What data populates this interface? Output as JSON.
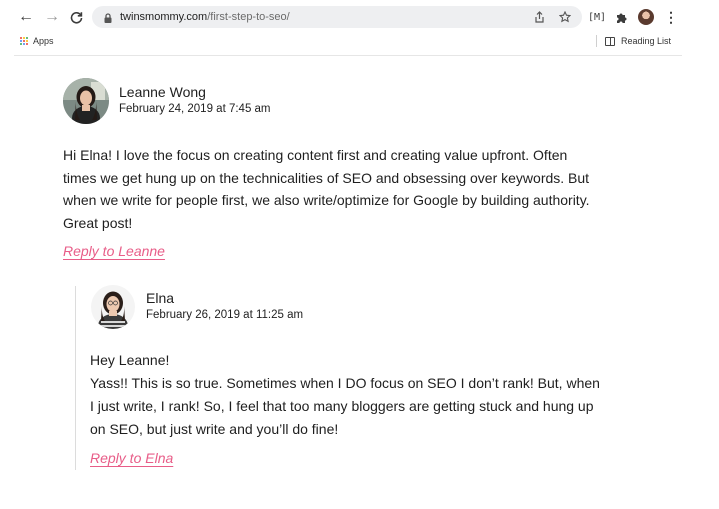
{
  "browser": {
    "url_domain": "twinsmommy.com",
    "url_path": "/first-step-to-seo/",
    "bookmarks": {
      "apps_label": "Apps",
      "reading_list_label": "Reading List"
    },
    "icons": [
      "back-arrow-icon",
      "forward-arrow-icon",
      "reload-icon",
      "lock-icon",
      "share-icon",
      "star-icon",
      "extension-icon",
      "puzzle-icon",
      "profile-avatar",
      "kebab-menu-icon"
    ]
  },
  "comments": {
    "first": {
      "author": "Leanne Wong",
      "date": "February 24, 2019 at 7:45 am",
      "lines": [
        "Hi Elna! I love the focus on creating content first and creating value upfront. Often",
        "times we get hung up on the technicalities of SEO and obsessing over keywords. But",
        "when we write for people first, we also write/optimize for Google by building authority.",
        "Great post!"
      ],
      "reply_label": "Reply to Leanne"
    },
    "reply": {
      "author": "Elna",
      "date": "February 26, 2019 at 11:25 am",
      "lines": [
        "Hey Leanne!",
        "Yass!! This is so true. Sometimes when I DO focus on SEO I don’t rank! But, when",
        "I just write, I rank! So, I feel that too many bloggers are getting stuck and hung up",
        "on SEO, but just write and you’ll do fine!"
      ],
      "reply_label": "Reply to Elna"
    }
  },
  "colors": {
    "link": "#e85d88",
    "text": "#1f1f1f",
    "omnibox": "#eeeff1"
  }
}
